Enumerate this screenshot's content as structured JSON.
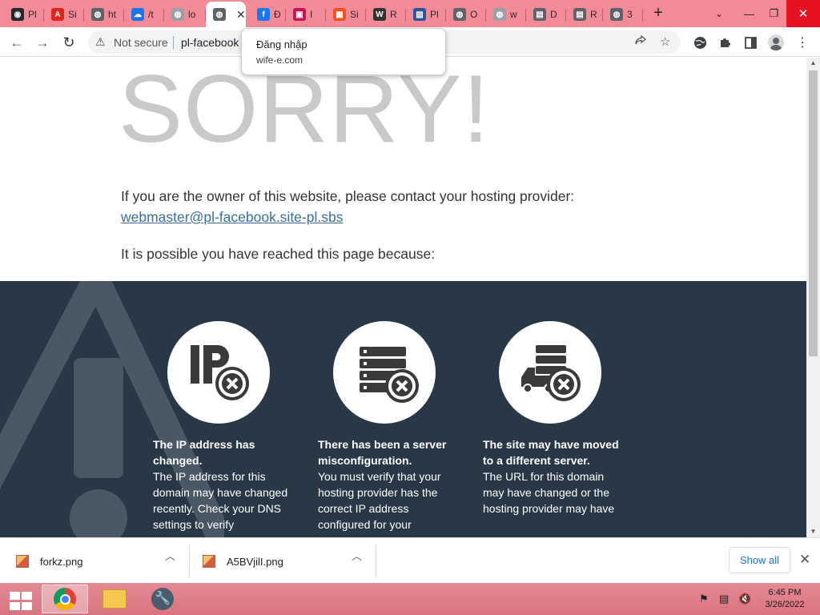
{
  "tabs": [
    {
      "label": "Pl",
      "icon": "github-icon",
      "color": "#24292f"
    },
    {
      "label": "Si",
      "icon": "adobe-icon",
      "color": "#e1251b"
    },
    {
      "label": "ht",
      "icon": "globe-icon",
      "color": "#5f6368"
    },
    {
      "label": "/t",
      "icon": "cloud-icon",
      "color": "#1a73e8"
    },
    {
      "label": "lo",
      "icon": "globe-icon",
      "color": "#9aa0a6"
    },
    {
      "label": "",
      "icon": "globe-icon",
      "color": "#5f6368",
      "active": true
    },
    {
      "label": "Đ",
      "icon": "facebook-icon",
      "color": "#1877f2"
    },
    {
      "label": "I",
      "icon": "shop-icon",
      "color": "#c2185b"
    },
    {
      "label": "Si",
      "icon": "microsoft-icon",
      "color": "#f25022"
    },
    {
      "label": "R",
      "icon": "wikipedia-icon",
      "color": "#333333"
    },
    {
      "label": "Pl",
      "icon": "image-icon",
      "color": "#2b579a"
    },
    {
      "label": "O",
      "icon": "globe-icon",
      "color": "#5f6368"
    },
    {
      "label": "w",
      "icon": "globe-icon",
      "color": "#9aa0a6"
    },
    {
      "label": "D",
      "icon": "doc-icon",
      "color": "#5f6368"
    },
    {
      "label": "R",
      "icon": "doc-icon",
      "color": "#5f6368"
    },
    {
      "label": "3",
      "icon": "globe-icon",
      "color": "#5f6368"
    }
  ],
  "new_tab": "+",
  "window": {
    "tab_search": "⌄",
    "minimize": "—",
    "restore": "❐",
    "close": "✕"
  },
  "toolbar": {
    "back": "←",
    "forward": "→",
    "reload": "↻",
    "security_icon": "⚠",
    "not_secure": "Not secure",
    "url": "pl-facebook"
  },
  "tooltip": {
    "title": "Đăng nhập",
    "subtitle": "wife-e.com"
  },
  "page": {
    "heading": "SORRY!",
    "owner_text": "If you are the owner of this website, please contact your hosting provider:",
    "email": "webmaster@pl-facebook.site-pl.sbs",
    "possible_text": "It is possible you have reached this page because:",
    "reasons": [
      {
        "title": "The IP address has changed.",
        "body": "The IP address for this domain may have changed recently. Check your DNS settings to verify",
        "icon": "ip-error-icon"
      },
      {
        "title": "There has been a server misconfiguration.",
        "body": "You must verify that your hosting provider has the correct IP address configured for your",
        "icon": "server-error-icon"
      },
      {
        "title": "The site may have moved to a different server.",
        "body": "The URL for this domain may have changed or the hosting provider may have",
        "icon": "truck-server-error-icon"
      }
    ],
    "band_color": "#293846"
  },
  "downloads": {
    "items": [
      {
        "name": "forkz.png"
      },
      {
        "name": "A5BVjilI.png"
      }
    ],
    "show_all": "Show all",
    "close": "✕"
  },
  "taskbar": {
    "time": "6:45 PM",
    "date": "3/26/2022"
  }
}
